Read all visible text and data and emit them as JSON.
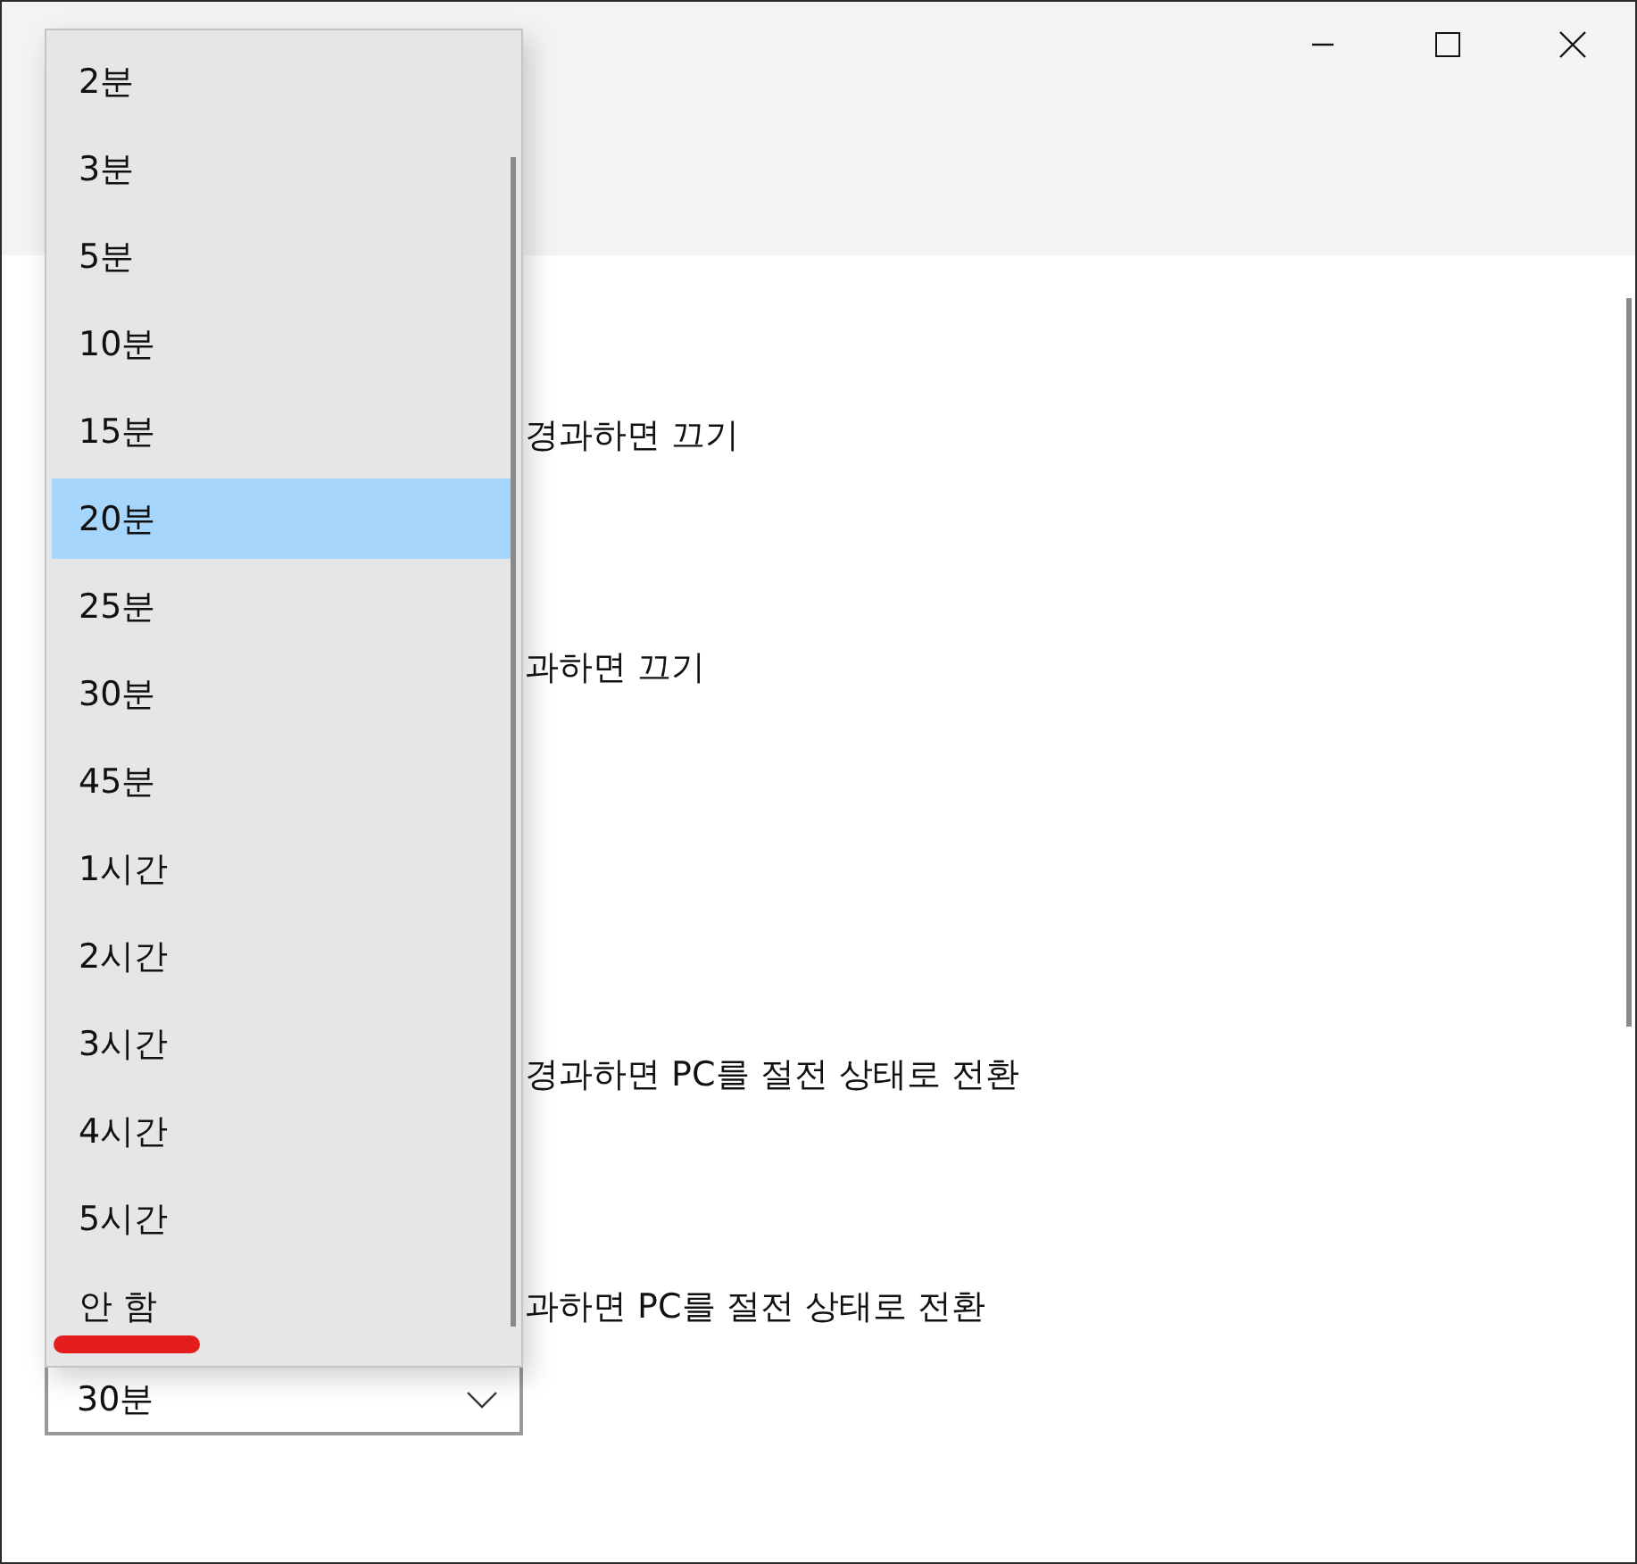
{
  "window": {
    "controls": [
      {
        "kind": "minimize"
      },
      {
        "kind": "maximize"
      },
      {
        "kind": "close"
      }
    ]
  },
  "settings": [
    {
      "text": "경과하면 끄기"
    },
    {
      "text": "과하면 끄기"
    },
    {
      "text": "경과하면 PC를 절전 상태로 전환"
    },
    {
      "text": "과하면 PC를 절전 상태로 전환"
    }
  ],
  "combo": {
    "value": "30분",
    "expanded": true
  },
  "dropdown": {
    "items": [
      {
        "label": "2분",
        "selected": false,
        "underlined": false
      },
      {
        "label": "3분",
        "selected": false,
        "underlined": false
      },
      {
        "label": "5분",
        "selected": false,
        "underlined": false
      },
      {
        "label": "10분",
        "selected": false,
        "underlined": false
      },
      {
        "label": "15분",
        "selected": false,
        "underlined": false
      },
      {
        "label": "20분",
        "selected": true,
        "underlined": false
      },
      {
        "label": "25분",
        "selected": false,
        "underlined": false
      },
      {
        "label": "30분",
        "selected": false,
        "underlined": false
      },
      {
        "label": "45분",
        "selected": false,
        "underlined": false
      },
      {
        "label": "1시간",
        "selected": false,
        "underlined": false
      },
      {
        "label": "2시간",
        "selected": false,
        "underlined": false
      },
      {
        "label": "3시간",
        "selected": false,
        "underlined": false
      },
      {
        "label": "4시간",
        "selected": false,
        "underlined": false
      },
      {
        "label": "5시간",
        "selected": false,
        "underlined": false
      },
      {
        "label": "안 함",
        "selected": false,
        "underlined": true
      }
    ]
  }
}
